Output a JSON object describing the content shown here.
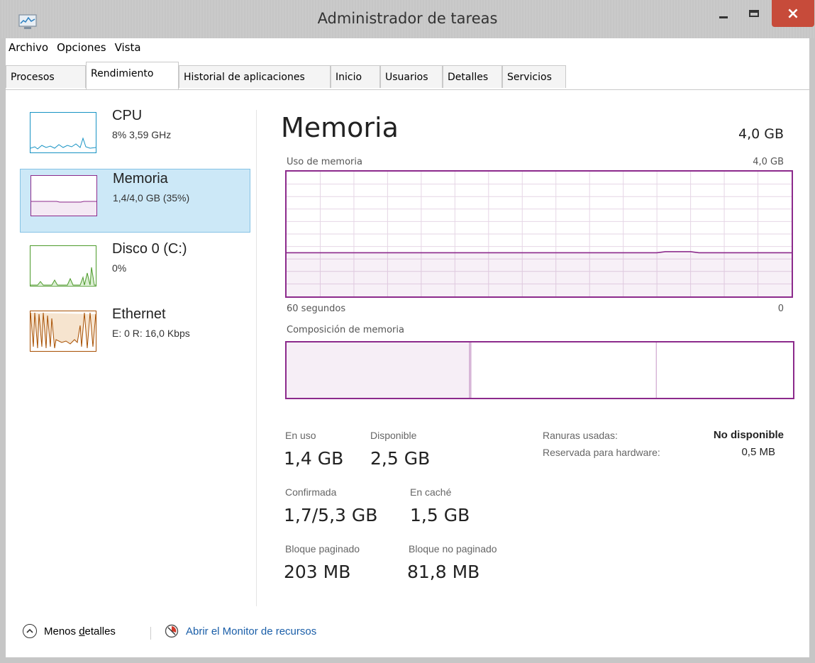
{
  "window": {
    "title": "Administrador de tareas",
    "close_glyph": "×"
  },
  "menu": [
    "Archivo",
    "Opciones",
    "Vista"
  ],
  "tabs": [
    "Procesos",
    "Rendimiento",
    "Historial de aplicaciones",
    "Inicio",
    "Usuarios",
    "Detalles",
    "Servicios"
  ],
  "active_tab": "Rendimiento",
  "sidebar": [
    {
      "name": "CPU",
      "sub": "8% 3,59 GHz",
      "color": "#1793c4"
    },
    {
      "name": "Memoria",
      "sub": "1,4/4,0 GB (35%)",
      "color": "#8c2a8c",
      "selected": true
    },
    {
      "name": "Disco 0 (C:)",
      "sub": "0%",
      "color": "#4c9a2a"
    },
    {
      "name": "Ethernet",
      "sub": "E: 0 R: 16,0 Kbps",
      "color": "#a74f01"
    }
  ],
  "main": {
    "title": "Memoria",
    "total": "4,0 GB",
    "usage_label": "Uso de memoria",
    "usage_max": "4,0 GB",
    "time_left": "60 segundos",
    "time_right": "0",
    "usage_level": 0.35,
    "composition_label": "Composición de memoria",
    "composition": {
      "in_use_fraction": 0.36,
      "modified_fraction": 0.005,
      "standby_fraction": 0.365
    },
    "stats": {
      "en_uso_label": "En uso",
      "en_uso": "1,4 GB",
      "disponible_label": "Disponible",
      "disponible": "2,5 GB",
      "confirmada_label": "Confirmada",
      "confirmada": "1,7/5,3 GB",
      "en_cache_label": "En caché",
      "en_cache": "1,5 GB",
      "paginado_label": "Bloque paginado",
      "paginado": "203 MB",
      "no_paginado_label": "Bloque no paginado",
      "no_paginado": "81,8 MB"
    },
    "details": {
      "ranuras_label": "Ranuras usadas:",
      "ranuras": "No disponible",
      "reservada_label": "Reservada para hardware:",
      "reservada": "0,5 MB"
    }
  },
  "footer": {
    "less_details_pre": "Menos ",
    "less_details_u": "d",
    "less_details_post": "etalles",
    "monitor_link": "Abrir el Monitor de recursos"
  },
  "colors": {
    "memory": "#8c2a8c",
    "selected_bg": "#cce8f7",
    "link": "#1a5ea8",
    "close": "#c74b3a"
  }
}
